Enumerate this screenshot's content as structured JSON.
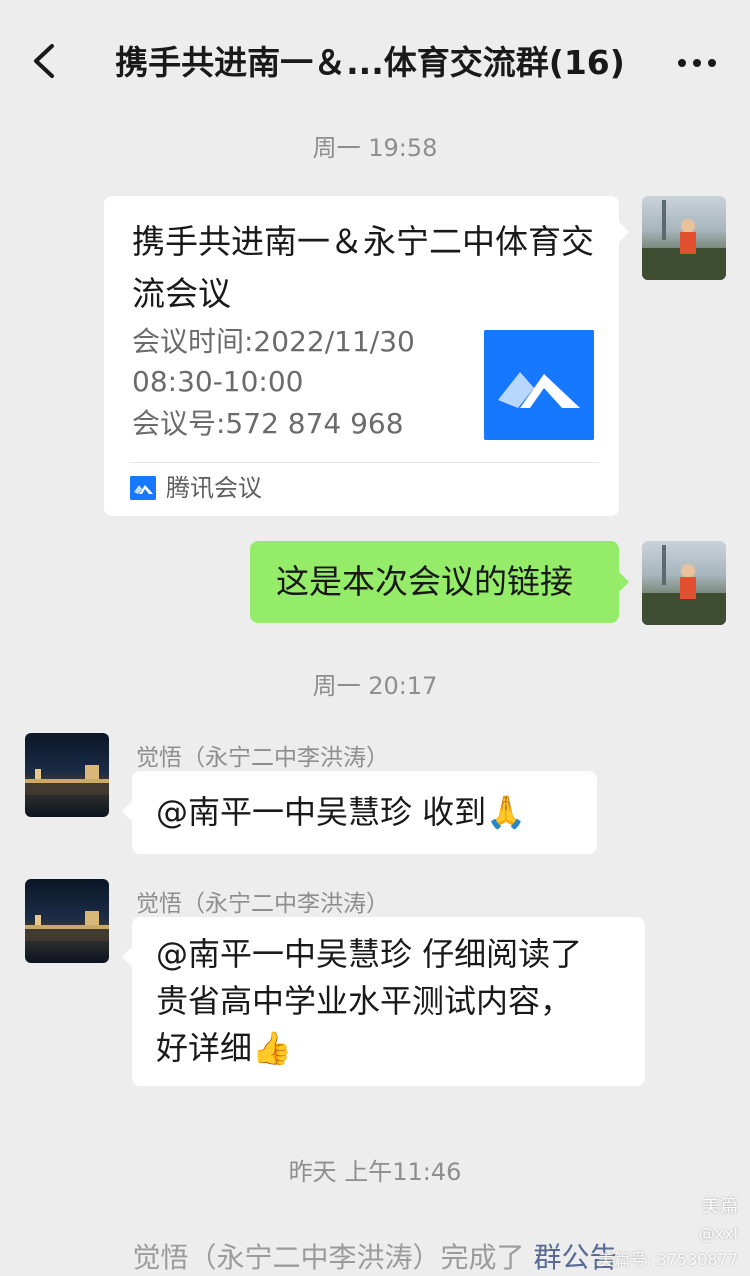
{
  "header": {
    "back_icon": "chevron-left-icon",
    "title": "携手共进南一＆...体育交流群(16)",
    "more_icon": "more-dots-icon"
  },
  "messages": {
    "time1": "周一 19:58",
    "card": {
      "title": "携手共进南一＆永宁二中体育交流会议",
      "line1": "会议时间:2022/11/30",
      "line2": "08:30-10:00",
      "line3": "会议号:572 874 968",
      "logo_icon": "tencent-meeting-logo-icon",
      "source": "腾讯会议",
      "brand_color": "#1677ff"
    },
    "outgoing_text": "这是本次会议的链接",
    "time2": "周一 20:17",
    "sender1": "觉悟（永宁二中李洪涛）",
    "reply1": "@南平一中吴慧珍  收到",
    "reply1_emoji": "🙏",
    "sender2": "觉悟（永宁二中李洪涛）",
    "reply2_line1": "@南平一中吴慧珍  仔细阅读了",
    "reply2_line2": "贵省高中学业水平测试内容，",
    "reply2_line3": "好详细",
    "reply2_emoji": "👍",
    "time3": "昨天 上午11:46",
    "system_prefix": "觉悟（永宁二中李洪涛）完成了 ",
    "system_link": "群公告"
  },
  "watermark": {
    "brand": "美篇",
    "user": "@xxl",
    "id": "美篇号: 37530877"
  },
  "colors": {
    "background": "#ededed",
    "outgoing_bubble": "#95ec69",
    "incoming_bubble": "#ffffff",
    "link": "#576b95"
  }
}
